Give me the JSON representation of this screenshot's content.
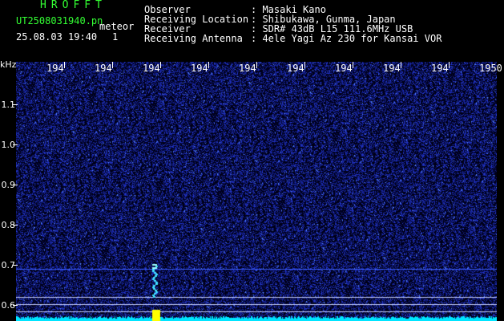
{
  "header": {
    "brand": "HROFFT",
    "filename": "UT2508031940.pn",
    "tag": "meteor",
    "datetime": "25.08.03 19:40",
    "count": "1"
  },
  "info": [
    {
      "label": "Observer",
      "value": ": Masaki Kano"
    },
    {
      "label": "Receiving Location",
      "value": ": Shibukawa, Gunma, Japan"
    },
    {
      "label": "Receiver",
      "value": ": SDR# 43dB L15 111.6MHz USB"
    },
    {
      "label": "Receiving Antenna",
      "value": ": 4ele Yagi Az 230 for Kansai VOR"
    }
  ],
  "axis": {
    "y_unit": "kHz",
    "y_ticks": [
      "1.1",
      "1.0",
      "0.9",
      "0.8",
      "0.7",
      "0.6"
    ],
    "x_ticks": [
      "194",
      "194",
      "194",
      "194",
      "194",
      "194",
      "194",
      "194",
      "194",
      "1950"
    ]
  },
  "colors": {
    "background": "#000000",
    "noise": "#1a2fd0",
    "echo": "#40e0ff",
    "baseline": "#00e5ff",
    "marker": "#ffff00"
  }
}
